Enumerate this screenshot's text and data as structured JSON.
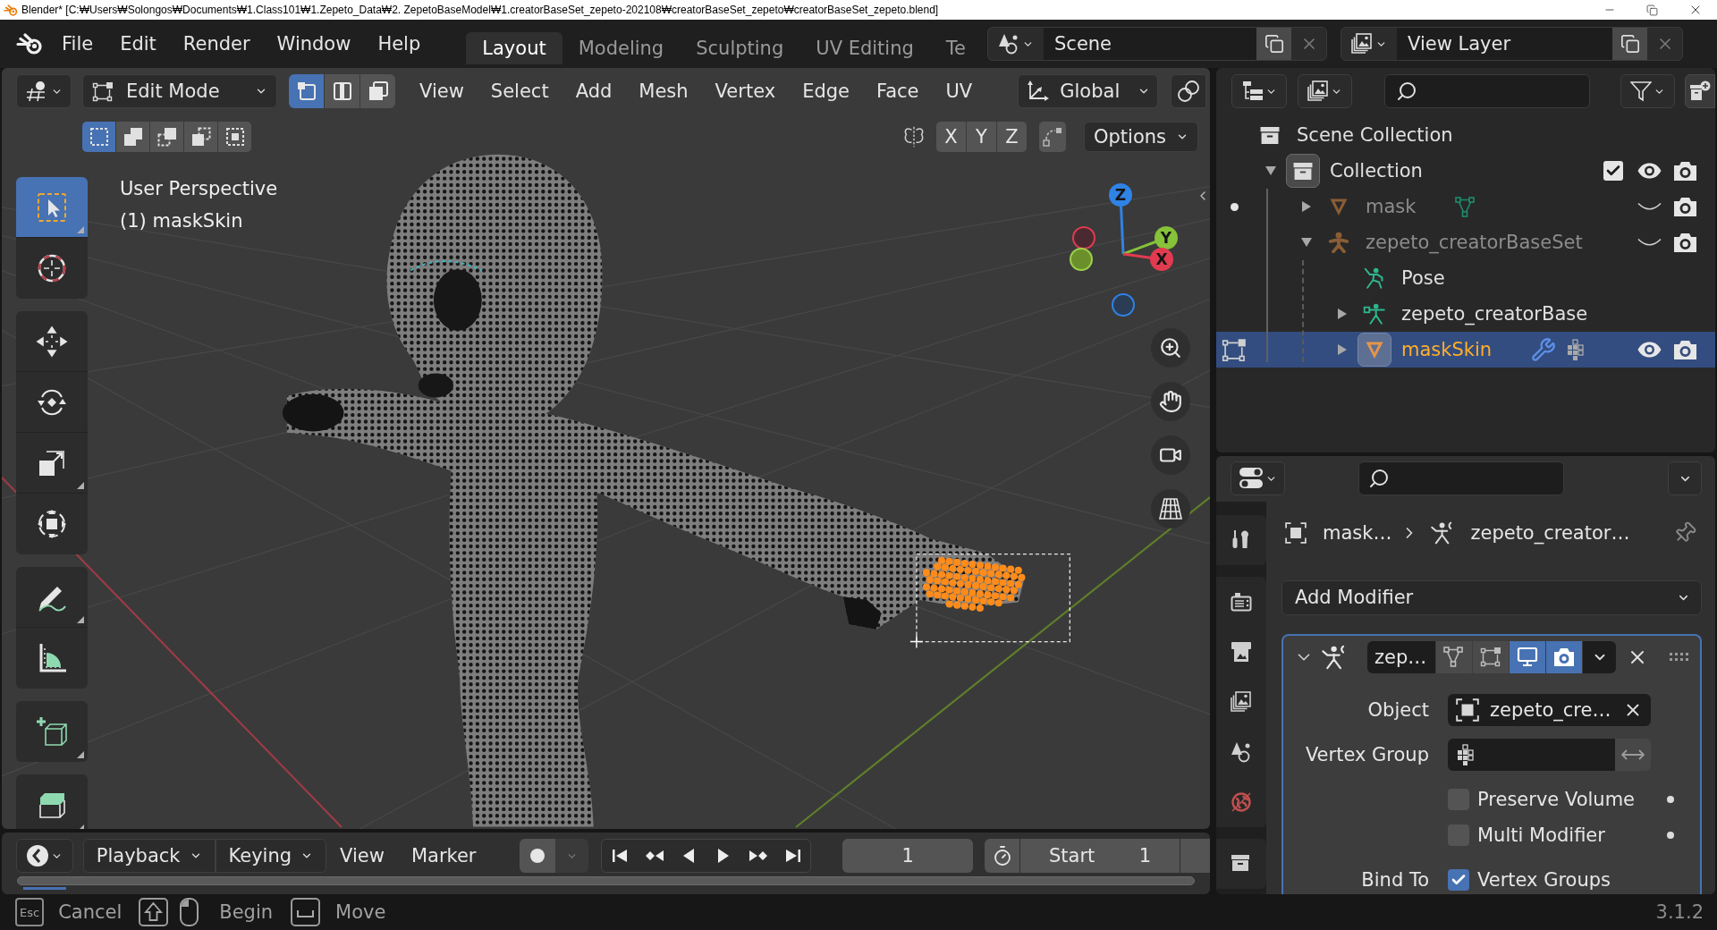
{
  "title_bar": {
    "title": "Blender* [C:₩Users₩Solongos₩Documents₩1.Class101₩1.Zepeto_Data₩2. ZepetoBaseModel₩1.creatorBaseSet_zepeto-202108₩creatorBaseSet_zepeto₩creatorBaseSet_zepeto.blend]"
  },
  "menu_bar": [
    "File",
    "Edit",
    "Render",
    "Window",
    "Help"
  ],
  "workspaces": [
    {
      "label": "Layout",
      "selected": true
    },
    {
      "label": "Modeling",
      "selected": false
    },
    {
      "label": "Sculpting",
      "selected": false
    },
    {
      "label": "UV Editing",
      "selected": false
    },
    {
      "label": "Te",
      "selected": false
    }
  ],
  "scene": {
    "value": "Scene"
  },
  "view_layer": {
    "value": "View Layer"
  },
  "viewport": {
    "mode": "Edit Mode",
    "select_modes": [
      {
        "kind": "vertex",
        "selected": true
      },
      {
        "kind": "edge",
        "selected": false
      },
      {
        "kind": "face",
        "selected": false
      }
    ],
    "menus": [
      "View",
      "Select",
      "Add",
      "Mesh",
      "Vertex",
      "Edge",
      "Face",
      "UV"
    ],
    "orientation": "Global",
    "box_select_modes": [
      {
        "kind": "set",
        "selected": true
      },
      {
        "kind": "extend",
        "selected": false
      },
      {
        "kind": "subtract",
        "selected": false
      },
      {
        "kind": "invert",
        "selected": false
      },
      {
        "kind": "intersect",
        "selected": false
      }
    ],
    "mirror_axes": [
      {
        "label": "X",
        "on": false
      },
      {
        "label": "Y",
        "on": false
      },
      {
        "label": "Z",
        "on": false
      }
    ],
    "options": "Options",
    "info": [
      "User Perspective",
      "(1) maskSkin"
    ],
    "tool_groups": [
      {
        "tools": [
          {
            "kind": "select-box",
            "selected": true,
            "has_submenu": true
          },
          {
            "kind": "cursor",
            "selected": false,
            "has_submenu": false
          }
        ]
      },
      {
        "tools": [
          {
            "kind": "move",
            "selected": false,
            "has_submenu": false
          },
          {
            "kind": "rotate",
            "selected": false,
            "has_submenu": false
          },
          {
            "kind": "scale",
            "selected": false,
            "has_submenu": true
          },
          {
            "kind": "transform",
            "selected": false,
            "has_submenu": false
          }
        ]
      },
      {
        "tools": [
          {
            "kind": "annotate",
            "selected": false,
            "has_submenu": true
          },
          {
            "kind": "measure",
            "selected": false,
            "has_submenu": false
          }
        ]
      },
      {
        "tools": [
          {
            "kind": "add-cube",
            "selected": false,
            "has_submenu": true
          }
        ]
      },
      {
        "tools": [
          {
            "kind": "extrude",
            "selected": false,
            "has_submenu": true
          }
        ]
      }
    ],
    "gizmo": [
      {
        "kind": "z",
        "label": "Z"
      },
      {
        "kind": "y",
        "label": "Y"
      },
      {
        "kind": "x",
        "label": "X"
      }
    ]
  },
  "outliner": {
    "tree": [
      {
        "label": "Scene Collection",
        "kind": "scene-collection",
        "selected": false,
        "active": false,
        "children": [
          {
            "label": "Collection",
            "kind": "collection",
            "selected": false,
            "active": true,
            "expanded": true,
            "checked": true,
            "hidden": false,
            "children": [
              {
                "label": "mask",
                "kind": "mesh",
                "selected": false,
                "active": false,
                "expanded": false,
                "hidden": true,
                "editing": false,
                "extras": [
                  {
                    "kind": "mesh-data"
                  }
                ]
              },
              {
                "label": "zepeto_creatorBaseSet",
                "kind": "armature",
                "selected": false,
                "active": false,
                "expanded": true,
                "hidden": true,
                "children": [
                  {
                    "label": "Pose",
                    "kind": "pose",
                    "selected": false,
                    "active": false
                  },
                  {
                    "label": "zepeto_creatorBase",
                    "kind": "armature-data",
                    "selected": false,
                    "active": false,
                    "expanded": false
                  },
                  {
                    "label": "maskSkin",
                    "kind": "mesh",
                    "selected": true,
                    "active": true,
                    "expanded": false,
                    "hidden": false,
                    "editing": true,
                    "extras": [
                      {
                        "kind": "modifier"
                      },
                      {
                        "kind": "vertex-groups"
                      }
                    ]
                  }
                ]
              }
            ]
          }
        ]
      }
    ]
  },
  "properties": {
    "tab_groups": [
      {
        "tabs": [
          {
            "kind": "tool"
          }
        ]
      },
      {
        "tabs": [
          {
            "kind": "render"
          },
          {
            "kind": "output"
          },
          {
            "kind": "view-layer"
          },
          {
            "kind": "scene"
          },
          {
            "kind": "world"
          }
        ]
      },
      {
        "tabs": [
          {
            "kind": "collection"
          }
        ]
      }
    ],
    "breadcrumb": [
      {
        "kind": "object",
        "label": "mask…"
      },
      {
        "kind": "armature",
        "label": "zepeto_creator…"
      }
    ],
    "add_modifier": "Add Modifier",
    "modifier": {
      "name": "zep…",
      "expanded": true,
      "toggles": [
        {
          "kind": "edit-mode",
          "on": false
        },
        {
          "kind": "on-cage",
          "on": false
        },
        {
          "kind": "viewport",
          "on": true
        },
        {
          "kind": "render",
          "on": true
        }
      ],
      "object": {
        "label": "Object",
        "value": "zepeto_cre…"
      },
      "vertex_group": {
        "label": "Vertex Group"
      },
      "options": [
        {
          "label": "Preserve Volume",
          "checked": false
        },
        {
          "label": "Multi Modifier",
          "checked": false
        }
      ],
      "bind_to": {
        "label": "Bind To",
        "option": {
          "label": "Vertex Groups",
          "checked": true
        }
      }
    }
  },
  "timeline": {
    "menus": [
      {
        "label": "Playback",
        "kind": "dropdown"
      },
      {
        "label": "Keying",
        "kind": "dropdown"
      },
      {
        "label": "View",
        "kind": "menu"
      },
      {
        "label": "Marker",
        "kind": "menu"
      }
    ],
    "auto_keying": false,
    "current_frame": "1",
    "start": {
      "label": "Start",
      "value": "1"
    }
  },
  "status_bar": {
    "hints": [
      {
        "kind": "key",
        "key": "Esc",
        "label": "Cancel"
      },
      {
        "kind": "shift-click",
        "label": "Begin"
      },
      {
        "kind": "space",
        "label": "Move"
      }
    ],
    "version": "3.1.2"
  }
}
